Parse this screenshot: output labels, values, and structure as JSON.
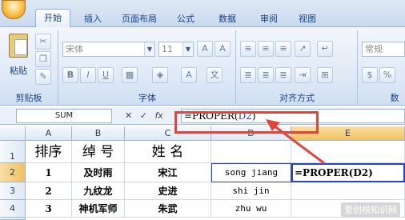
{
  "ribbon": {
    "tabs": [
      "开始",
      "插入",
      "页面布局",
      "公式",
      "数据",
      "审阅",
      "视图"
    ],
    "font_name": "宋体",
    "font_size": "11",
    "number_format": "常规",
    "paste_label": "粘贴",
    "groups": {
      "clipboard": "剪贴板",
      "font": "字体",
      "alignment": "对齐方式",
      "number": "数"
    }
  },
  "formula_bar": {
    "name_box": "SUM",
    "fx": "fx",
    "formula_prefix": "=PROPER(",
    "formula_ref": "D2",
    "formula_suffix": ")"
  },
  "sheet": {
    "columns": [
      "A",
      "B",
      "C",
      "D",
      "E"
    ],
    "rows": [
      "1",
      "2",
      "3",
      "4"
    ],
    "headers": [
      "排序",
      "绰 号",
      "姓 名"
    ],
    "data": [
      [
        "1",
        "及时雨",
        "宋江",
        "song jiang",
        "=PROPER(D2)"
      ],
      [
        "2",
        "九纹龙",
        "史进",
        "shi jin",
        ""
      ],
      [
        "3",
        "神机军师",
        "朱武",
        "zhu wu",
        ""
      ]
    ]
  },
  "watermark": "爱创根知识网",
  "colors": {
    "callout": "#e0453a",
    "selection": "#2a3fd6"
  }
}
